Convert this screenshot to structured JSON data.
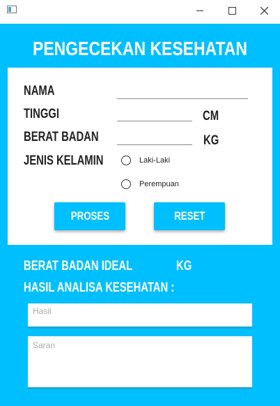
{
  "window": {
    "title_icon": "window-icon",
    "minimize_icon": "minimize-icon",
    "maximize_icon": "maximize-icon",
    "close_icon": "close-icon"
  },
  "header": {
    "title": "PENGECEKAN KESEHATAN"
  },
  "form": {
    "nama_label": "NAMA",
    "nama_value": "",
    "tinggi_label": "TINGGI",
    "tinggi_value": "",
    "tinggi_unit": "CM",
    "berat_label": "BERAT BADAN",
    "berat_value": "",
    "berat_unit": "KG",
    "jenis_label": "JENIS KELAMIN",
    "gender_options": [
      {
        "label": "Laki-Laki",
        "selected": false
      },
      {
        "label": "Perempuan",
        "selected": false
      }
    ],
    "proses_label": "PROSES",
    "reset_label": "RESET"
  },
  "result": {
    "ideal_label": "BERAT BADAN IDEAL",
    "ideal_value": "",
    "ideal_unit": "KG",
    "analisa_label": "HASIL ANALISA KESEHATAN :",
    "hasil_placeholder": "Hasil",
    "saran_placeholder": "Saran"
  },
  "colors": {
    "accent": "#00bfff",
    "field_underline": "#1aa6d8",
    "text_dark": "#222222"
  }
}
